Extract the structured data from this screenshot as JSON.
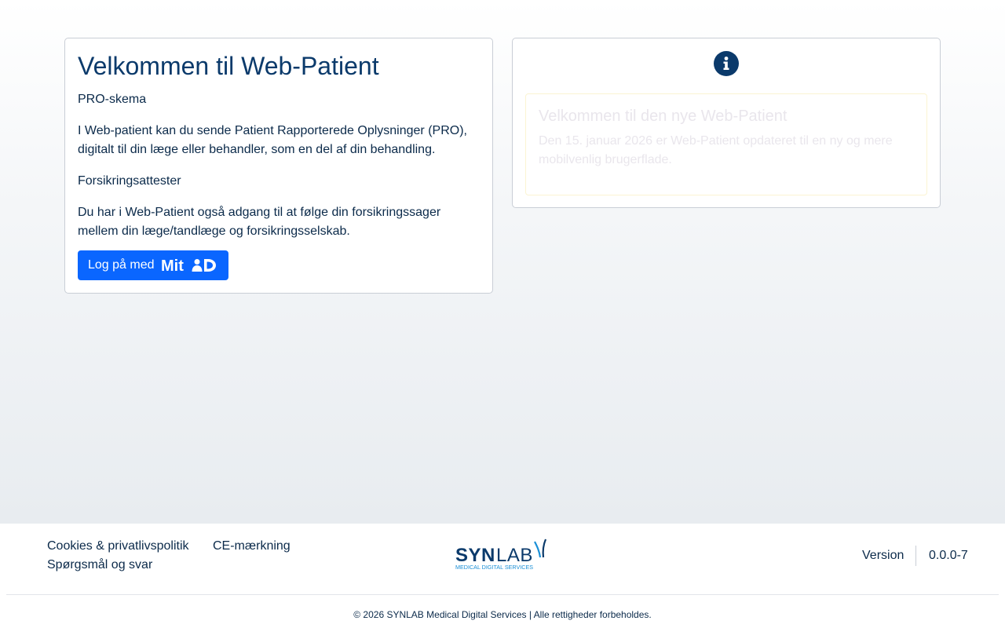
{
  "welcome": {
    "title": "Velkommen til Web-Patient",
    "pro_label": "PRO-skema",
    "pro_text": "I Web-patient kan du sende Patient Rapporterede Oplysninger (PRO), digitalt til din læge eller behandler, som en del af din behandling.",
    "insurance_label": "Forsikringsattester",
    "insurance_text": "Du har i Web-Patient også adgang til at følge din forsikringssager mellem din læge/tandlæge og forsikringsselskab.",
    "login_label": "Log på med",
    "login_logo_text": "MitID"
  },
  "notice": {
    "icon": "info-icon",
    "title": "Velkommen til den nye Web-Patient",
    "text": "Den 15. januar 2026 er Web-Patient opdateret til en ny og mere mobilvenlig brugerflade."
  },
  "footer": {
    "links": {
      "cookies": "Cookies & privatlivspolitik",
      "ce": "CE-mærkning",
      "faq": "Spørgsmål og svar"
    },
    "logo": {
      "brand_bold": "SYN",
      "brand_light": "LAB",
      "tagline": "MEDICAL DIGITAL SERVICES"
    },
    "version_label": "Version",
    "version_value": "0.0.0-7",
    "copyright": "© 2026 SYNLAB Medical Digital Services | Alle rettigheder forbeholdes."
  },
  "colors": {
    "primary_button": "#0a66ff",
    "title_blue": "#0b3a6b",
    "text_dark": "#0b2a4a",
    "info_icon_bg": "#0b3a6b"
  }
}
